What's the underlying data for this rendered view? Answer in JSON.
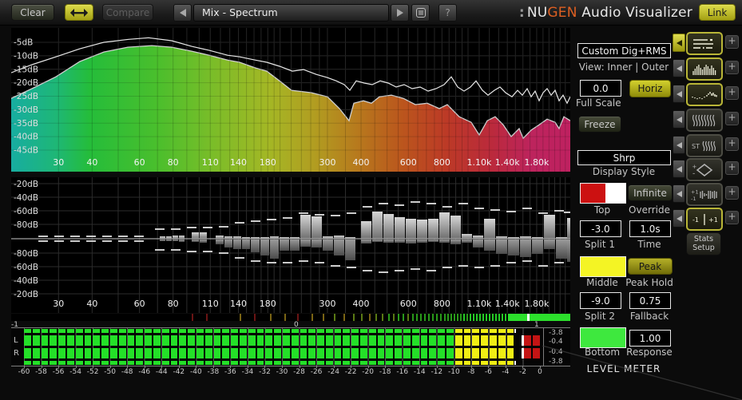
{
  "toolbar": {
    "clear_label": "Clear",
    "compare_label": "Compare",
    "preset_name": "Mix - Spectrum",
    "help_label": "?",
    "logo": {
      "dots": ":",
      "prefix": "NU",
      "accent": "GEN",
      "suffix": " Audio Visualizer"
    },
    "link_label": "Link"
  },
  "freq_axis": {
    "min": 20,
    "max": 2400,
    "grid_freqs": [
      30,
      40,
      50,
      60,
      70,
      80,
      90,
      100,
      110,
      120,
      130,
      140,
      150,
      160,
      170,
      180,
      190,
      200,
      220,
      240,
      260,
      280,
      300,
      350,
      400,
      450,
      500,
      550,
      600,
      650,
      700,
      750,
      800,
      850,
      900,
      950,
      1000,
      1100,
      1200,
      1300,
      1400,
      1500,
      1600,
      1700,
      1800,
      1900,
      2000,
      2100,
      2200,
      2300
    ],
    "labels": [
      {
        "t": "30",
        "f": 30
      },
      {
        "t": "40",
        "f": 40
      },
      {
        "t": "60",
        "f": 60
      },
      {
        "t": "80",
        "f": 80
      },
      {
        "t": "110",
        "f": 110
      },
      {
        "t": "140",
        "f": 140
      },
      {
        "t": "180",
        "f": 180
      },
      {
        "t": "300",
        "f": 300
      },
      {
        "t": "400",
        "f": 400
      },
      {
        "t": "600",
        "f": 600
      },
      {
        "t": "800",
        "f": 800
      },
      {
        "t": "1.10k",
        "f": 1100
      },
      {
        "t": "1.40k",
        "f": 1400
      },
      {
        "t": "1.80k",
        "f": 1800
      }
    ]
  },
  "spectrum": {
    "db_labels": [
      "-5dB",
      "-10dB",
      "-15dB",
      "-20dB",
      "-25dB",
      "-30dB",
      "-35dB",
      "-40dB",
      "-45dB"
    ],
    "gradient": [
      [
        0,
        "#18b2a6"
      ],
      [
        8,
        "#1fbd7a"
      ],
      [
        14,
        "#26c33c"
      ],
      [
        26,
        "#4cc52e"
      ],
      [
        36,
        "#7ec32a"
      ],
      [
        46,
        "#a9bd26"
      ],
      [
        54,
        "#b7a322"
      ],
      [
        62,
        "#bd7d1e"
      ],
      [
        70,
        "#c1581e"
      ],
      [
        78,
        "#c23b28"
      ],
      [
        86,
        "#c12b3e"
      ],
      [
        93,
        "#c32560"
      ],
      [
        100,
        "#c52263"
      ]
    ],
    "fill_points": [
      [
        0,
        -25.8
      ],
      [
        26,
        -22.2
      ],
      [
        56,
        -17.8
      ],
      [
        86,
        -12.1
      ],
      [
        116,
        -8.6
      ],
      [
        146,
        -6.8
      ],
      [
        176,
        -6.2
      ],
      [
        201,
        -6.8
      ],
      [
        226,
        -8.3
      ],
      [
        248,
        -9.8
      ],
      [
        271,
        -11.6
      ],
      [
        286,
        -12.4
      ],
      [
        306,
        -14.5
      ],
      [
        320,
        -15.7
      ],
      [
        336,
        -19.3
      ],
      [
        351,
        -22.8
      ],
      [
        376,
        -23.7
      ],
      [
        396,
        -25.2
      ],
      [
        411,
        -29.6
      ],
      [
        423,
        -34.1
      ],
      [
        429,
        -27.6
      ],
      [
        441,
        -26.7
      ],
      [
        451,
        -27.6
      ],
      [
        461,
        -25.2
      ],
      [
        476,
        -24.6
      ],
      [
        491,
        -25.8
      ],
      [
        506,
        -28.1
      ],
      [
        521,
        -27.6
      ],
      [
        536,
        -29.6
      ],
      [
        546,
        -28.1
      ],
      [
        561,
        -32.6
      ],
      [
        576,
        -34.7
      ],
      [
        586,
        -39.4
      ],
      [
        596,
        -34.1
      ],
      [
        606,
        -32.6
      ],
      [
        616,
        -35.6
      ],
      [
        626,
        -40
      ],
      [
        636,
        -37
      ],
      [
        641,
        -40.6
      ],
      [
        651,
        -37.6
      ],
      [
        661,
        -35.6
      ],
      [
        671,
        -33.5
      ],
      [
        681,
        -34.7
      ],
      [
        686,
        -37
      ],
      [
        692,
        -32.6
      ],
      [
        700,
        -34.1
      ]
    ],
    "outer_points": [
      [
        0,
        -16.3
      ],
      [
        26,
        -13.3
      ],
      [
        56,
        -10.4
      ],
      [
        86,
        -7.4
      ],
      [
        116,
        -5
      ],
      [
        147,
        -3.9
      ],
      [
        172,
        -3.3
      ],
      [
        201,
        -4.4
      ],
      [
        226,
        -6.5
      ],
      [
        248,
        -8
      ],
      [
        271,
        -9.8
      ],
      [
        286,
        -10.4
      ],
      [
        306,
        -11.6
      ],
      [
        320,
        -12.4
      ],
      [
        336,
        -13.9
      ],
      [
        352,
        -15.7
      ],
      [
        366,
        -15.1
      ],
      [
        382,
        -16.9
      ],
      [
        396,
        -18.1
      ],
      [
        407,
        -19.3
      ],
      [
        417,
        -20.7
      ],
      [
        424,
        -22.8
      ],
      [
        432,
        -19.3
      ],
      [
        442,
        -20.1
      ],
      [
        452,
        -20.7
      ],
      [
        462,
        -19.3
      ],
      [
        472,
        -20.1
      ],
      [
        482,
        -21.6
      ],
      [
        492,
        -20.7
      ],
      [
        502,
        -22.2
      ],
      [
        512,
        -21.6
      ],
      [
        522,
        -23.1
      ],
      [
        532,
        -22.2
      ],
      [
        542,
        -20.7
      ],
      [
        551,
        -17.8
      ],
      [
        559,
        -21.6
      ],
      [
        567,
        -23.1
      ],
      [
        575,
        -21.6
      ],
      [
        582,
        -19.3
      ],
      [
        590,
        -22.8
      ],
      [
        597,
        -24.6
      ],
      [
        605,
        -22.8
      ],
      [
        612,
        -21.6
      ],
      [
        619,
        -23.7
      ],
      [
        627,
        -25.2
      ],
      [
        634,
        -22.8
      ],
      [
        640,
        -24.6
      ],
      [
        646,
        -22.2
      ],
      [
        651,
        -25.2
      ],
      [
        656,
        -23.1
      ],
      [
        661,
        -26.7
      ],
      [
        666,
        -23.7
      ],
      [
        671,
        -22.2
      ],
      [
        676,
        -24.6
      ],
      [
        681,
        -22.8
      ],
      [
        686,
        -26.7
      ],
      [
        691,
        -24.6
      ],
      [
        696,
        -27.6
      ],
      [
        700,
        -25.2
      ]
    ]
  },
  "bargraph": {
    "db_labels": [
      "-20dB",
      "-40dB",
      "-60dB",
      "-80dB"
    ],
    "bars": [
      [
        186,
        7,
        3,
        2
      ],
      [
        194,
        7,
        3,
        2
      ],
      [
        202,
        7,
        4,
        2
      ],
      [
        210,
        7,
        4,
        3
      ],
      [
        226,
        9,
        8,
        3
      ],
      [
        236,
        9,
        8,
        4
      ],
      [
        256,
        10,
        4,
        6
      ],
      [
        267,
        10,
        3,
        10
      ],
      [
        278,
        10,
        3,
        12
      ],
      [
        289,
        10,
        2,
        12
      ],
      [
        300,
        11,
        2,
        16
      ],
      [
        312,
        11,
        2,
        20
      ],
      [
        324,
        11,
        3,
        24
      ],
      [
        336,
        12,
        2,
        14
      ],
      [
        349,
        12,
        2,
        14
      ],
      [
        362,
        13,
        30,
        9
      ],
      [
        376,
        13,
        28,
        10
      ],
      [
        390,
        13,
        3,
        14
      ],
      [
        404,
        13,
        4,
        20
      ],
      [
        418,
        13,
        2,
        26
      ],
      [
        438,
        13,
        22,
        5
      ],
      [
        452,
        13,
        34,
        3
      ],
      [
        466,
        13,
        31,
        4
      ],
      [
        480,
        13,
        27,
        4
      ],
      [
        494,
        13,
        25,
        5
      ],
      [
        508,
        13,
        24,
        4
      ],
      [
        522,
        13,
        25,
        3
      ],
      [
        536,
        13,
        33,
        4
      ],
      [
        550,
        13,
        29,
        6
      ],
      [
        564,
        13,
        6,
        4
      ],
      [
        578,
        13,
        4,
        10
      ],
      [
        592,
        14,
        25,
        14
      ],
      [
        607,
        14,
        3,
        18
      ],
      [
        622,
        14,
        2,
        20
      ],
      [
        637,
        14,
        3,
        22
      ],
      [
        652,
        14,
        2,
        18
      ],
      [
        667,
        14,
        30,
        12
      ],
      [
        682,
        14,
        2,
        24
      ],
      [
        696,
        4,
        26,
        28
      ]
    ],
    "dashes_up": [
      [
        40,
        3
      ],
      [
        60,
        3
      ],
      [
        80,
        3
      ],
      [
        100,
        3
      ],
      [
        120,
        3
      ],
      [
        140,
        3
      ],
      [
        160,
        3
      ],
      [
        186,
        12
      ],
      [
        206,
        12
      ],
      [
        226,
        14
      ],
      [
        246,
        14
      ],
      [
        266,
        15
      ],
      [
        286,
        20
      ],
      [
        306,
        22
      ],
      [
        326,
        24
      ],
      [
        346,
        26
      ],
      [
        366,
        32
      ],
      [
        386,
        30
      ],
      [
        406,
        29
      ],
      [
        426,
        32
      ],
      [
        446,
        40
      ],
      [
        466,
        44
      ],
      [
        486,
        42
      ],
      [
        506,
        46
      ],
      [
        526,
        44
      ],
      [
        546,
        40
      ],
      [
        566,
        44
      ],
      [
        586,
        38
      ],
      [
        606,
        36
      ],
      [
        626,
        34
      ],
      [
        646,
        38
      ],
      [
        666,
        32
      ],
      [
        686,
        35
      ],
      [
        698,
        33
      ]
    ],
    "dashes_dn": [
      [
        40,
        3
      ],
      [
        60,
        3
      ],
      [
        80,
        3
      ],
      [
        100,
        3
      ],
      [
        120,
        3
      ],
      [
        140,
        3
      ],
      [
        160,
        3
      ],
      [
        186,
        14
      ],
      [
        206,
        14
      ],
      [
        226,
        16
      ],
      [
        246,
        16
      ],
      [
        266,
        18
      ],
      [
        286,
        24
      ],
      [
        306,
        28
      ],
      [
        326,
        30
      ],
      [
        346,
        30
      ],
      [
        366,
        28
      ],
      [
        386,
        30
      ],
      [
        406,
        34
      ],
      [
        426,
        36
      ],
      [
        446,
        40
      ],
      [
        466,
        42
      ],
      [
        486,
        40
      ],
      [
        506,
        38
      ],
      [
        526,
        40
      ],
      [
        546,
        36
      ],
      [
        566,
        34
      ],
      [
        586,
        36
      ],
      [
        606,
        34
      ],
      [
        626,
        30
      ],
      [
        646,
        28
      ],
      [
        666,
        34
      ],
      [
        686,
        30
      ]
    ]
  },
  "correlation": {
    "labels": {
      "left": "-1",
      "mid": "0",
      "right": "1"
    },
    "colors": [
      "#6a1414",
      "#7a6414",
      "#5a7a14",
      "#2a9a1a",
      "#26cc26"
    ],
    "ticks": [
      [
        226,
        0
      ],
      [
        244,
        0
      ],
      [
        286,
        1
      ],
      [
        304,
        0
      ],
      [
        324,
        1
      ],
      [
        342,
        1
      ],
      [
        358,
        0
      ],
      [
        376,
        1
      ],
      [
        390,
        1
      ],
      [
        404,
        2
      ],
      [
        416,
        1
      ],
      [
        428,
        2
      ],
      [
        438,
        2
      ],
      [
        448,
        1
      ],
      [
        456,
        2
      ],
      [
        464,
        2
      ],
      [
        472,
        3
      ],
      [
        478,
        2
      ],
      [
        484,
        3
      ],
      [
        490,
        3
      ],
      [
        496,
        2
      ],
      [
        502,
        3
      ],
      [
        507,
        3
      ],
      [
        512,
        3
      ],
      [
        517,
        3
      ],
      [
        522,
        3
      ],
      [
        527,
        3
      ],
      [
        532,
        3
      ],
      [
        537,
        3
      ],
      [
        542,
        3
      ],
      [
        546,
        3
      ],
      [
        550,
        3
      ],
      [
        554,
        3
      ],
      [
        558,
        3
      ],
      [
        562,
        3
      ],
      [
        566,
        4
      ],
      [
        570,
        3
      ],
      [
        574,
        4
      ],
      [
        578,
        4
      ],
      [
        582,
        4
      ],
      [
        586,
        4
      ],
      [
        590,
        4
      ],
      [
        594,
        4
      ],
      [
        598,
        4
      ],
      [
        602,
        4
      ],
      [
        606,
        4
      ],
      [
        610,
        4
      ],
      [
        614,
        4
      ],
      [
        618,
        4
      ]
    ],
    "block": {
      "start": 622,
      "end": 700,
      "color": "#2ce02c",
      "marker": 646
    }
  },
  "meter": {
    "left_labels": [
      "L",
      "R"
    ],
    "segments_total": 60,
    "rows": [
      {
        "kind": "rms",
        "green_to": 50,
        "yellow_to": 57,
        "value": "-3.8"
      },
      {
        "kind": "peak",
        "green_to": 50,
        "yellow_to": 57,
        "red_from": 58,
        "red_to": 60,
        "marker_pct": 96.5,
        "value": "-0.4"
      },
      {
        "kind": "peak",
        "green_to": 50,
        "yellow_to": 57,
        "red_from": 58,
        "red_to": 60,
        "marker_pct": 96.5,
        "value": "-0.4"
      },
      {
        "kind": "rms",
        "green_to": 50,
        "yellow_to": 57,
        "value": "-3.8"
      }
    ],
    "colors": {
      "green": "#24e028",
      "yellow": "#f0ee14",
      "red": "#c41414"
    },
    "scale": [
      "-60",
      "-58",
      "-56",
      "-54",
      "-52",
      "-50",
      "-48",
      "-46",
      "-44",
      "-42",
      "-40",
      "-38",
      "-36",
      "-34",
      "-32",
      "-30",
      "-28",
      "-26",
      "-24",
      "-22",
      "-20",
      "-18",
      "-16",
      "-14",
      "-12",
      "-10",
      "-8",
      "-6",
      "-4",
      "-2",
      "0"
    ]
  },
  "panel": {
    "mode_box": "Custom Dig+RMS",
    "view_label": "View: Inner | Outer",
    "full_scale": {
      "value": "0.0",
      "label": "Full Scale"
    },
    "horiz_label": "Horiz",
    "freeze_label": "Freeze",
    "display_style": {
      "value": "Shrp",
      "label": "Display Style"
    },
    "top": {
      "label": "Top",
      "color_left": "#cc1111",
      "color_right": "#ffffff"
    },
    "override": {
      "button": "Infinite",
      "label": "Override"
    },
    "split1": {
      "value": "-3.0",
      "label": "Split 1"
    },
    "time": {
      "value": "1.0s",
      "label": "Time"
    },
    "middle": {
      "label": "Middle",
      "color": "#f4f424"
    },
    "peak_hold": {
      "button": "Peak",
      "label": "Peak Hold"
    },
    "split2": {
      "value": "-9.0",
      "label": "Split 2"
    },
    "fallback": {
      "value": "0.75",
      "label": "Fallback"
    },
    "bottom": {
      "label": "Bottom",
      "color": "#3ee83e"
    },
    "response": {
      "value": "1.00",
      "label": "Response"
    },
    "section_title": "LEVEL METER"
  },
  "sidebar": {
    "add_label": "+",
    "modules": [
      {
        "name": "line-spectrum",
        "active": true,
        "arrow_active": true
      },
      {
        "name": "bar-spectrum",
        "active": true,
        "arrow_active": false
      },
      {
        "name": "scatter-spectrum",
        "active": true,
        "arrow_active": false
      },
      {
        "name": "spectrogram",
        "active": false,
        "arrow_active": false
      },
      {
        "name": "stereo-spectrogram",
        "active": false,
        "arrow_active": false,
        "text": "ST"
      },
      {
        "name": "vectorscope",
        "active": false,
        "arrow_active": false,
        "plus": "+",
        "minus": "-"
      },
      {
        "name": "correlation-history",
        "active": false,
        "arrow_active": false,
        "top": "+1",
        "bottom": "-1"
      },
      {
        "name": "correlation-meter",
        "active": true,
        "arrow_active": false,
        "left": "-1",
        "right": "+1"
      }
    ],
    "stats_line1": "Stats",
    "stats_line2": "Setup"
  }
}
